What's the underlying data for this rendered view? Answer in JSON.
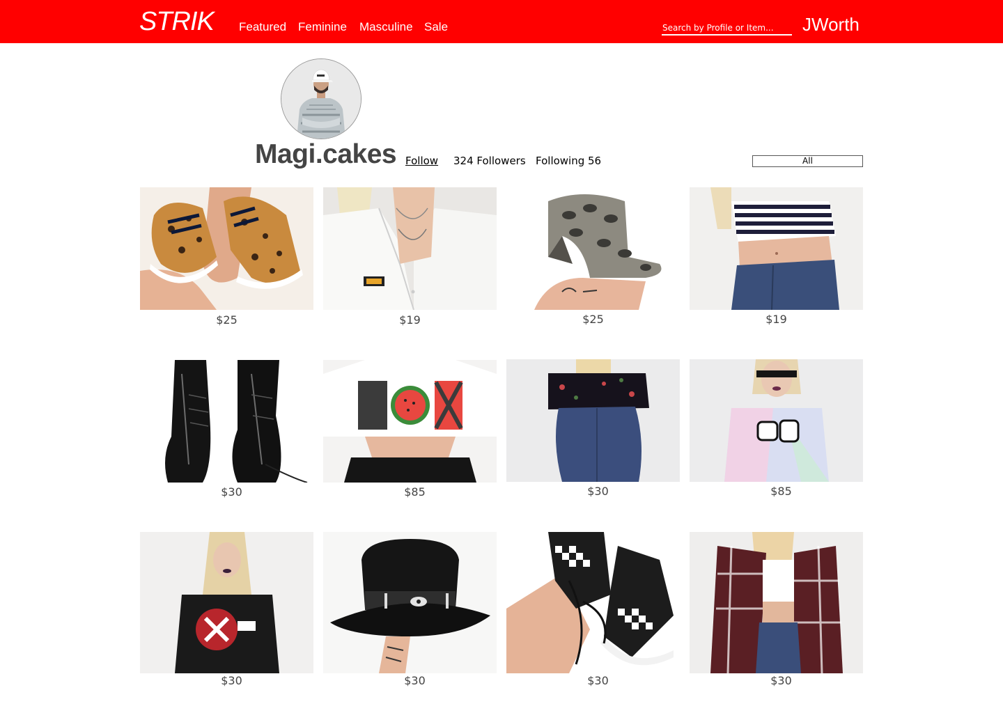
{
  "header": {
    "logo": "STRIK",
    "nav": [
      "Featured",
      "Feminine",
      "Masculine",
      "Sale"
    ],
    "search_placeholder": "Search by Profile or Item...",
    "user": "JWorth"
  },
  "profile": {
    "username": "Magi.cakes",
    "follow_label": "Follow",
    "followers_label": "324 Followers",
    "following_label": "Following 56",
    "filter_value": "All"
  },
  "items": [
    {
      "price": "$25",
      "photo": "leopard-sneakers"
    },
    {
      "price": "$19",
      "photo": "white-work-shirt"
    },
    {
      "price": "$25",
      "photo": "snakeskin-mules"
    },
    {
      "price": "$19",
      "photo": "striped-crop-top"
    },
    {
      "price": "$30",
      "photo": "patent-platform-boots"
    },
    {
      "price": "$85",
      "photo": "sex-crop-tee"
    },
    {
      "price": "$30",
      "photo": "floral-crop-top"
    },
    {
      "price": "$85",
      "photo": "tie-dye-tank"
    },
    {
      "price": "$30",
      "photo": "dead-kennedys-tee"
    },
    {
      "price": "$30",
      "photo": "black-wide-brim-hat"
    },
    {
      "price": "$30",
      "photo": "checkered-sk8-hi"
    },
    {
      "price": "$30",
      "photo": "plaid-flannel-shirt"
    }
  ],
  "colors": {
    "brand": "#ff0000",
    "text": "#444444"
  }
}
